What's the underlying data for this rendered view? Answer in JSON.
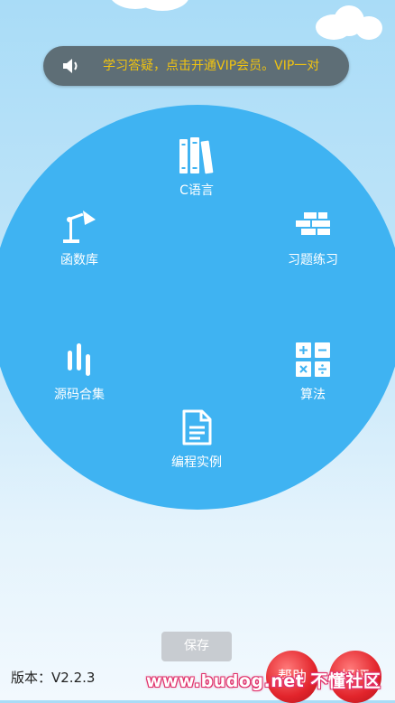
{
  "banner": {
    "icon": "speaker-icon",
    "text": "学习答疑，点击开通VIP会员。VIP一对"
  },
  "menu": {
    "items": [
      {
        "label": "C语言",
        "icon": "books-icon"
      },
      {
        "label": "函数库",
        "icon": "desk-lamp-icon"
      },
      {
        "label": "习题练习",
        "icon": "brick-wall-icon"
      },
      {
        "label": "源码合集",
        "icon": "bars-icon"
      },
      {
        "label": "算法",
        "icon": "calculator-icon"
      },
      {
        "label": "编程实例",
        "icon": "document-icon"
      }
    ]
  },
  "footer": {
    "save_label": "保存",
    "version": "版本：V2.2.3",
    "help_label": "帮助",
    "review_label": "好评",
    "watermark": "www.budog.net 不懂社区"
  },
  "colors": {
    "circle": "#3fb3f2",
    "banner_bg": "#5e6e76",
    "banner_text": "#f2c40f",
    "round_button": "#e2242b"
  }
}
